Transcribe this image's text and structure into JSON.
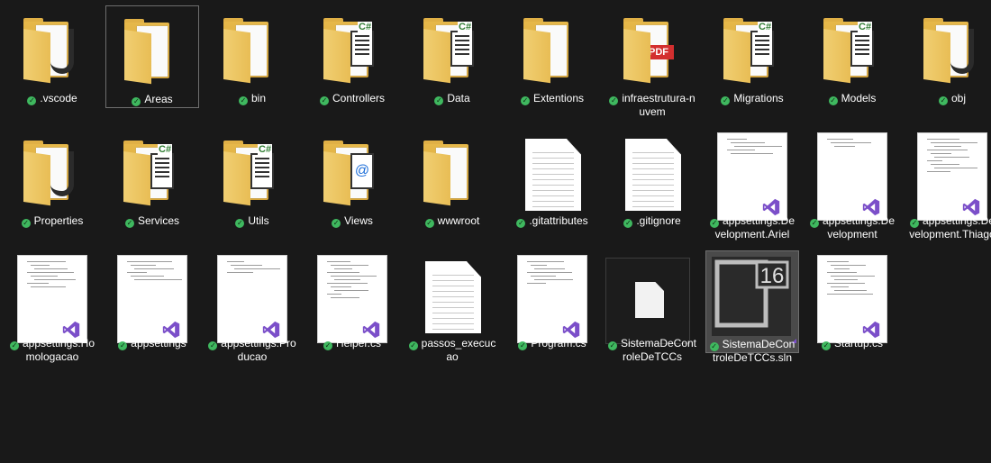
{
  "status_icon": "sync-check-icon",
  "colors": {
    "background": "#191919",
    "sync_green": "#3fb85f",
    "vs_purple": "#7b4fc9",
    "folder_yellow": "#e8bd55",
    "pdf_red": "#d32f2f"
  },
  "items": [
    {
      "name": ".vscode",
      "kind": "folder",
      "icon": "folder-vscode-icon"
    },
    {
      "name": "Areas",
      "kind": "folder",
      "icon": "folder-icon"
    },
    {
      "name": "bin",
      "kind": "folder",
      "icon": "folder-icon"
    },
    {
      "name": "Controllers",
      "kind": "folder",
      "icon": "folder-csharp-icon"
    },
    {
      "name": "Data",
      "kind": "folder",
      "icon": "folder-csharp-icon"
    },
    {
      "name": "Extentions",
      "kind": "folder",
      "icon": "folder-icon"
    },
    {
      "name": "infraestrutura-nuvem",
      "kind": "folder",
      "icon": "folder-pdf-icon"
    },
    {
      "name": "Migrations",
      "kind": "folder",
      "icon": "folder-csharp-icon"
    },
    {
      "name": "Models",
      "kind": "folder",
      "icon": "folder-csharp-icon"
    },
    {
      "name": "obj",
      "kind": "folder",
      "icon": "folder-vscode-icon"
    },
    {
      "name": "Properties",
      "kind": "folder",
      "icon": "folder-vscode-icon"
    },
    {
      "name": "Services",
      "kind": "folder",
      "icon": "folder-csharp-icon"
    },
    {
      "name": "Utils",
      "kind": "folder",
      "icon": "folder-csharp-icon"
    },
    {
      "name": "Views",
      "kind": "folder",
      "icon": "folder-razor-icon"
    },
    {
      "name": "wwwroot",
      "kind": "folder",
      "icon": "folder-icon"
    },
    {
      "name": ".gitattributes",
      "kind": "text",
      "icon": "text-file-icon"
    },
    {
      "name": ".gitignore",
      "kind": "text",
      "icon": "text-file-icon"
    },
    {
      "name": "appsettings.Development.Ariel",
      "kind": "vsdoc",
      "icon": "visual-studio-file-icon"
    },
    {
      "name": "appsettings.Development",
      "kind": "vsdoc",
      "icon": "visual-studio-file-icon"
    },
    {
      "name": "appsettings.Development.Thiago",
      "kind": "vsdoc",
      "icon": "visual-studio-file-icon"
    },
    {
      "name": "appsettings.Homologacao",
      "kind": "vsdoc",
      "icon": "visual-studio-file-icon"
    },
    {
      "name": "appsettings",
      "kind": "vsdoc",
      "icon": "visual-studio-file-icon"
    },
    {
      "name": "appsettings.Producao",
      "kind": "vsdoc",
      "icon": "visual-studio-file-icon"
    },
    {
      "name": "Helper.cs",
      "kind": "vsdoc",
      "icon": "visual-studio-file-icon"
    },
    {
      "name": "passos_execucao",
      "kind": "text",
      "icon": "text-file-icon"
    },
    {
      "name": "Program.cs",
      "kind": "vsdoc",
      "icon": "visual-studio-file-icon"
    },
    {
      "name": "SistemaDeControleDeTCCs",
      "kind": "dark",
      "icon": "generic-file-icon"
    },
    {
      "name": "SistemaDeControleDeTCCs.sln",
      "kind": "sln",
      "icon": "visual-studio-solution-icon",
      "version": "16"
    },
    {
      "name": "Startup.cs",
      "kind": "vsdoc",
      "icon": "visual-studio-file-icon"
    }
  ]
}
